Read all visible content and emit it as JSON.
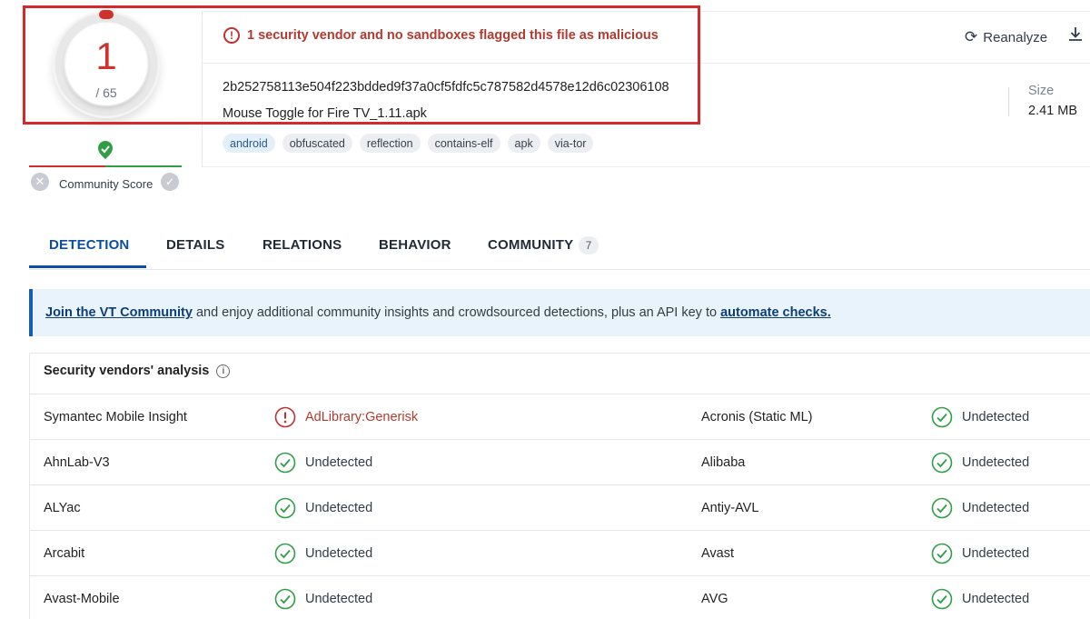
{
  "score": {
    "detections": "1",
    "total": "/ 65"
  },
  "alert": {
    "text": "1 security vendor and no sandboxes flagged this file as malicious"
  },
  "actions": {
    "reanalyze": "Reanalyze"
  },
  "file": {
    "hash": "2b252758113e504f223bdded9f37a0cf5fdfc5c787582d4578e12d6c02306108",
    "name": "Mouse Toggle for Fire TV_1.11.apk",
    "size_label": "Size",
    "size_value": "2.41 MB",
    "tags": [
      "android",
      "obfuscated",
      "reflection",
      "contains-elf",
      "apk",
      "via-tor"
    ]
  },
  "community_score": {
    "label": "Community Score"
  },
  "tabs": [
    {
      "label": "DETECTION"
    },
    {
      "label": "DETAILS"
    },
    {
      "label": "RELATIONS"
    },
    {
      "label": "BEHAVIOR"
    },
    {
      "label": "COMMUNITY",
      "count": "7"
    }
  ],
  "banner": {
    "link1": "Join the VT Community",
    "text": " and enjoy additional community insights and crowdsourced detections, plus an API key to ",
    "link2": "automate checks."
  },
  "vendors": {
    "header": "Security vendors' analysis",
    "rows": [
      {
        "left_name": "Symantec Mobile Insight",
        "left_result": "AdLibrary:Generisk",
        "left_status": "malicious",
        "right_name": "Acronis (Static ML)",
        "right_result": "Undetected",
        "right_status": "clean"
      },
      {
        "left_name": "AhnLab-V3",
        "left_result": "Undetected",
        "left_status": "clean",
        "right_name": "Alibaba",
        "right_result": "Undetected",
        "right_status": "clean"
      },
      {
        "left_name": "ALYac",
        "left_result": "Undetected",
        "left_status": "clean",
        "right_name": "Antiy-AVL",
        "right_result": "Undetected",
        "right_status": "clean"
      },
      {
        "left_name": "Arcabit",
        "left_result": "Undetected",
        "left_status": "clean",
        "right_name": "Avast",
        "right_result": "Undetected",
        "right_status": "clean"
      },
      {
        "left_name": "Avast-Mobile",
        "left_result": "Undetected",
        "left_status": "clean",
        "right_name": "AVG",
        "right_result": "Undetected",
        "right_status": "clean"
      }
    ]
  },
  "colors": {
    "malicious": "#b33a2f",
    "clean": "#2f9e44",
    "accent": "#0b4ea2",
    "highlight": "#d42a2a"
  },
  "icons": {
    "alert": "alert-circle-icon",
    "reanalyze": "refresh-icon",
    "download": "download-icon",
    "community_check": "shield-check-icon",
    "community_down": "x-circle-icon",
    "community_up": "check-circle-icon",
    "info": "info-icon",
    "clean": "check-circle-icon",
    "malicious": "alert-circle-icon"
  }
}
